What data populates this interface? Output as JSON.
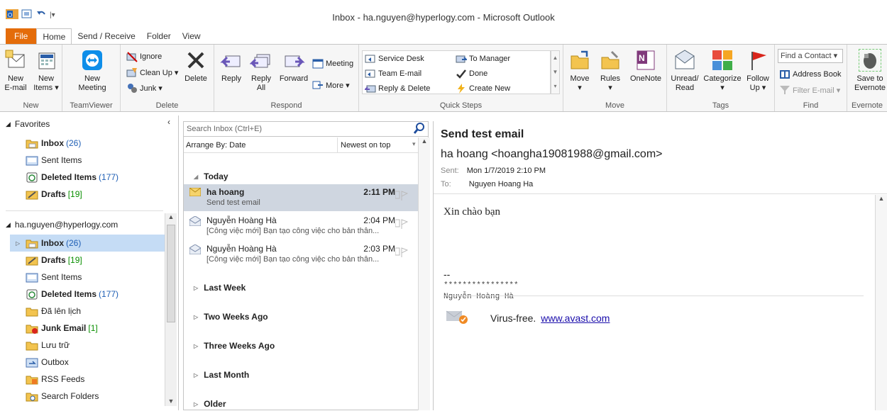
{
  "window": {
    "title": "Inbox - ha.nguyen@hyperlogy.com - Microsoft Outlook"
  },
  "tabs": [
    "File",
    "Home",
    "Send / Receive",
    "Folder",
    "View"
  ],
  "ribbon": {
    "new": {
      "new_email": [
        "New",
        "E-mail"
      ],
      "new_items": [
        "New",
        "Items ▾"
      ],
      "label": "New"
    },
    "teamviewer": {
      "new_meeting": [
        "New",
        "Meeting"
      ],
      "label": "TeamViewer"
    },
    "delete": {
      "ignore": "Ignore",
      "cleanup": "Clean Up ▾",
      "junk": "Junk ▾",
      "delete": "Delete",
      "label": "Delete"
    },
    "respond": {
      "reply": "Reply",
      "reply_all": [
        "Reply",
        "All"
      ],
      "forward": "Forward",
      "meeting": "Meeting",
      "more": "More ▾",
      "label": "Respond"
    },
    "quicksteps": {
      "items": [
        "Service Desk",
        "To Manager",
        "Team E-mail",
        "Done",
        "Reply & Delete",
        "Create New"
      ],
      "label": "Quick Steps"
    },
    "move": {
      "move": [
        "Move",
        "▾"
      ],
      "rules": [
        "Rules",
        "▾"
      ],
      "onenote": "OneNote",
      "label": "Move"
    },
    "tags": {
      "unread": [
        "Unread/",
        "Read"
      ],
      "categorize": [
        "Categorize",
        "▾"
      ],
      "follow": [
        "Follow",
        "Up ▾"
      ],
      "label": "Tags"
    },
    "find": {
      "contact_placeholder": "Find a Contact ▾",
      "address_book": "Address Book",
      "filter": "Filter E-mail ▾",
      "label": "Find"
    },
    "evernote": {
      "save": [
        "Save to",
        "Evernote"
      ],
      "label": "Evernote"
    }
  },
  "nav": {
    "favorites_label": "Favorites",
    "favorites": [
      {
        "name": "Inbox",
        "count": "(26)",
        "bold": true
      },
      {
        "name": "Sent Items",
        "count": "",
        "bold": false
      },
      {
        "name": "Deleted Items",
        "count": "(177)",
        "bold": true
      },
      {
        "name": "Drafts",
        "count": "[19]",
        "bold": true
      }
    ],
    "account": "ha.nguyen@hyperlogy.com",
    "folders": [
      {
        "name": "Inbox",
        "count": "(26)",
        "bold": true,
        "selected": true
      },
      {
        "name": "Drafts",
        "count": "[19]",
        "bold": true
      },
      {
        "name": "Sent Items",
        "count": "",
        "bold": false
      },
      {
        "name": "Deleted Items",
        "count": "(177)",
        "bold": true
      },
      {
        "name": "Đã lên lịch",
        "count": "",
        "bold": false
      },
      {
        "name": "Junk Email",
        "count": "[1]",
        "bold": true
      },
      {
        "name": "Lưu trữ",
        "count": "",
        "bold": false
      },
      {
        "name": "Outbox",
        "count": "",
        "bold": false
      },
      {
        "name": "RSS Feeds",
        "count": "",
        "bold": false
      },
      {
        "name": "Search Folders",
        "count": "",
        "bold": false
      }
    ]
  },
  "list": {
    "search_placeholder": "Search Inbox (Ctrl+E)",
    "arrange": "Arrange By: Date",
    "order": "Newest on top",
    "today": "Today",
    "messages": [
      {
        "from": "ha hoang",
        "time": "2:11 PM",
        "subject": "Send test email"
      },
      {
        "from": "Nguyễn Hoàng Hà",
        "time": "2:04 PM",
        "subject": "[Công việc mới] Bạn tạo công việc cho bản thân..."
      },
      {
        "from": "Nguyễn Hoàng Hà",
        "time": "2:03 PM",
        "subject": "[Công việc mới] Bạn tạo công việc cho bản thân..."
      }
    ],
    "groups": [
      "Last Week",
      "Two Weeks Ago",
      "Three Weeks Ago",
      "Last Month",
      "Older"
    ]
  },
  "reading": {
    "subject": "Send test email",
    "sender": "ha hoang <hoangha19081988@gmail.com>",
    "sent_label": "Sent:",
    "sent": "Mon 1/7/2019 2:10 PM",
    "to_label": "To:",
    "to": "Nguyen Hoang Ha",
    "greeting": "Xin chào bạn",
    "sig_dash": "--",
    "sig_stars": "****************",
    "sig_name": "Nguyễn Hoàng Hà",
    "virus_text": "Virus-free.",
    "virus_link": "www.avast.com"
  },
  "colors": {
    "file_tab": "#e46c0a",
    "selected_row": "#c5dcf5",
    "selected_msg": "#cfd6e0",
    "link": "#1a0dab"
  }
}
